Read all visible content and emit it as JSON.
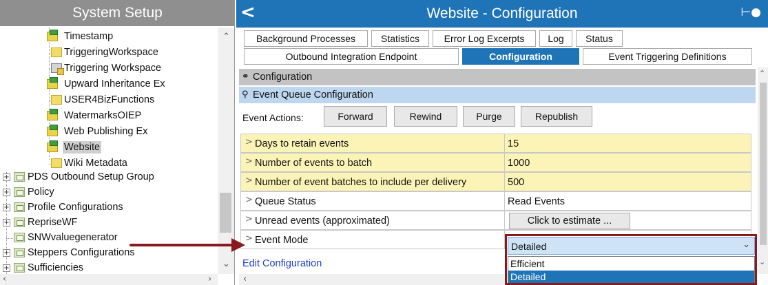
{
  "left_panel": {
    "title": "System Setup",
    "tree": [
      {
        "label": "Timestamp",
        "icon": "green-file-icon"
      },
      {
        "label": "TriggeringWorkspace",
        "icon": "yellow-file-icon"
      },
      {
        "label": "Triggering Workspace",
        "icon": "workspace-icon"
      },
      {
        "label": "Upward Inheritance Ex",
        "icon": "green-file-icon"
      },
      {
        "label": "USER4BizFunctions",
        "icon": "yellow-file-icon"
      },
      {
        "label": "WatermarksOIEP",
        "icon": "green-file-icon"
      },
      {
        "label": "Web Publishing Ex",
        "icon": "green-file-icon"
      },
      {
        "label": "Website",
        "icon": "green-file-icon",
        "selected": true
      },
      {
        "label": "Wiki Metadata",
        "icon": "yellow-file-icon"
      },
      {
        "label": "PDS Outbound Setup Group",
        "icon": "folder-icon",
        "expander": "+"
      },
      {
        "label": "Policy",
        "icon": "folder-icon",
        "expander": "+"
      },
      {
        "label": "Profile Configurations",
        "icon": "folder-icon",
        "expander": "+"
      },
      {
        "label": "RepriseWF",
        "icon": "folder-icon",
        "expander": "+"
      },
      {
        "label": "SNWvaluegenerator",
        "icon": "folder-icon"
      },
      {
        "label": "Steppers Configurations",
        "icon": "folder-icon",
        "expander": "+"
      },
      {
        "label": "Sufficiencies",
        "icon": "folder-icon",
        "expander": "+"
      }
    ]
  },
  "right_panel": {
    "title": "Website - Configuration",
    "tabs_row1": [
      {
        "label": "Background Processes"
      },
      {
        "label": "Statistics"
      },
      {
        "label": "Error Log Excerpts"
      },
      {
        "label": "Log"
      },
      {
        "label": "Status"
      }
    ],
    "tabs_row2": [
      {
        "label": "Outbound Integration Endpoint",
        "active": false
      },
      {
        "label": "Configuration",
        "active": true
      },
      {
        "label": "Event Triggering Definitions",
        "active": false
      }
    ],
    "section_configuration": "Configuration",
    "section_event_queue": "Event Queue Configuration",
    "event_actions": {
      "label": "Event Actions:",
      "buttons": [
        "Forward",
        "Rewind",
        "Purge",
        "Republish"
      ]
    },
    "properties": [
      {
        "name": "Days to retain events",
        "value": "15",
        "highlight": true
      },
      {
        "name": "Number of events to batch",
        "value": "1000",
        "highlight": true
      },
      {
        "name": "Number of event batches to include per delivery",
        "value": "500",
        "highlight": true
      },
      {
        "name": "Queue Status",
        "value": "Read Events",
        "highlight": false
      },
      {
        "name": "Unread events (approximated)",
        "value": "Click to estimate ...",
        "highlight": false
      },
      {
        "name": "Event Mode",
        "value": "Detailed",
        "highlight": false
      }
    ],
    "edit_link": "Edit Configuration",
    "event_mode_dropdown": {
      "selected": "Detailed",
      "options": [
        "Efficient",
        "Detailed"
      ]
    },
    "annotation_color": "#8b1a1f"
  }
}
